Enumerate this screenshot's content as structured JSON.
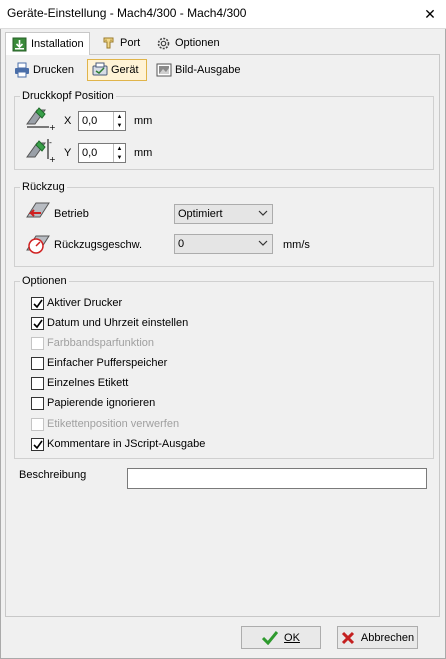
{
  "window": {
    "title": "Geräte-Einstellung -   Mach4/300   - Mach4/300",
    "close_glyph": "✕"
  },
  "main_tabs": [
    {
      "label": "Installation",
      "icon": "installation-icon"
    },
    {
      "label": "Port",
      "icon": "port-icon"
    },
    {
      "label": "Optionen",
      "icon": "gear-icon"
    }
  ],
  "sub_tabs": [
    {
      "label": "Drucken",
      "icon": "printer-icon"
    },
    {
      "label": "Gerät",
      "icon": "device-icon"
    },
    {
      "label": "Bild-Ausgabe",
      "icon": "image-icon"
    }
  ],
  "druckkopf": {
    "title": "Druckkopf Position",
    "x_label": "X",
    "x_value": "0,0",
    "x_unit": "mm",
    "y_label": "Y",
    "y_value": "0,0",
    "y_unit": "mm"
  },
  "rueckzug": {
    "title": "Rückzug",
    "betrieb_label": "Betrieb",
    "betrieb_value": "Optimiert",
    "geschw_label": "Rückzugsgeschw.",
    "geschw_value": "0",
    "geschw_unit": "mm/s"
  },
  "optionen": {
    "title": "Optionen",
    "items": [
      {
        "label": "Aktiver Drucker",
        "checked": true,
        "enabled": true
      },
      {
        "label": "Datum und Uhrzeit einstellen",
        "checked": true,
        "enabled": true
      },
      {
        "label": "Farbbandsparfunktion",
        "checked": false,
        "enabled": false
      },
      {
        "label": "Einfacher Pufferspeicher",
        "checked": false,
        "enabled": true
      },
      {
        "label": "Einzelnes Etikett",
        "checked": false,
        "enabled": true
      },
      {
        "label": "Papierende ignorieren",
        "checked": false,
        "enabled": true
      },
      {
        "label": "Etikettenposition verwerfen",
        "checked": false,
        "enabled": false
      },
      {
        "label": "Kommentare in JScript-Ausgabe",
        "checked": true,
        "enabled": true
      }
    ]
  },
  "beschreibung": {
    "label": "Beschreibung",
    "value": ""
  },
  "buttons": {
    "ok_label": "OK",
    "cancel_label": "Abbrechen"
  },
  "colors": {
    "active_subtab_bg": "#fff3d6",
    "active_subtab_border": "#e0b44a",
    "ok_check": "#2e9a2e",
    "cancel_x": "#c42020"
  }
}
